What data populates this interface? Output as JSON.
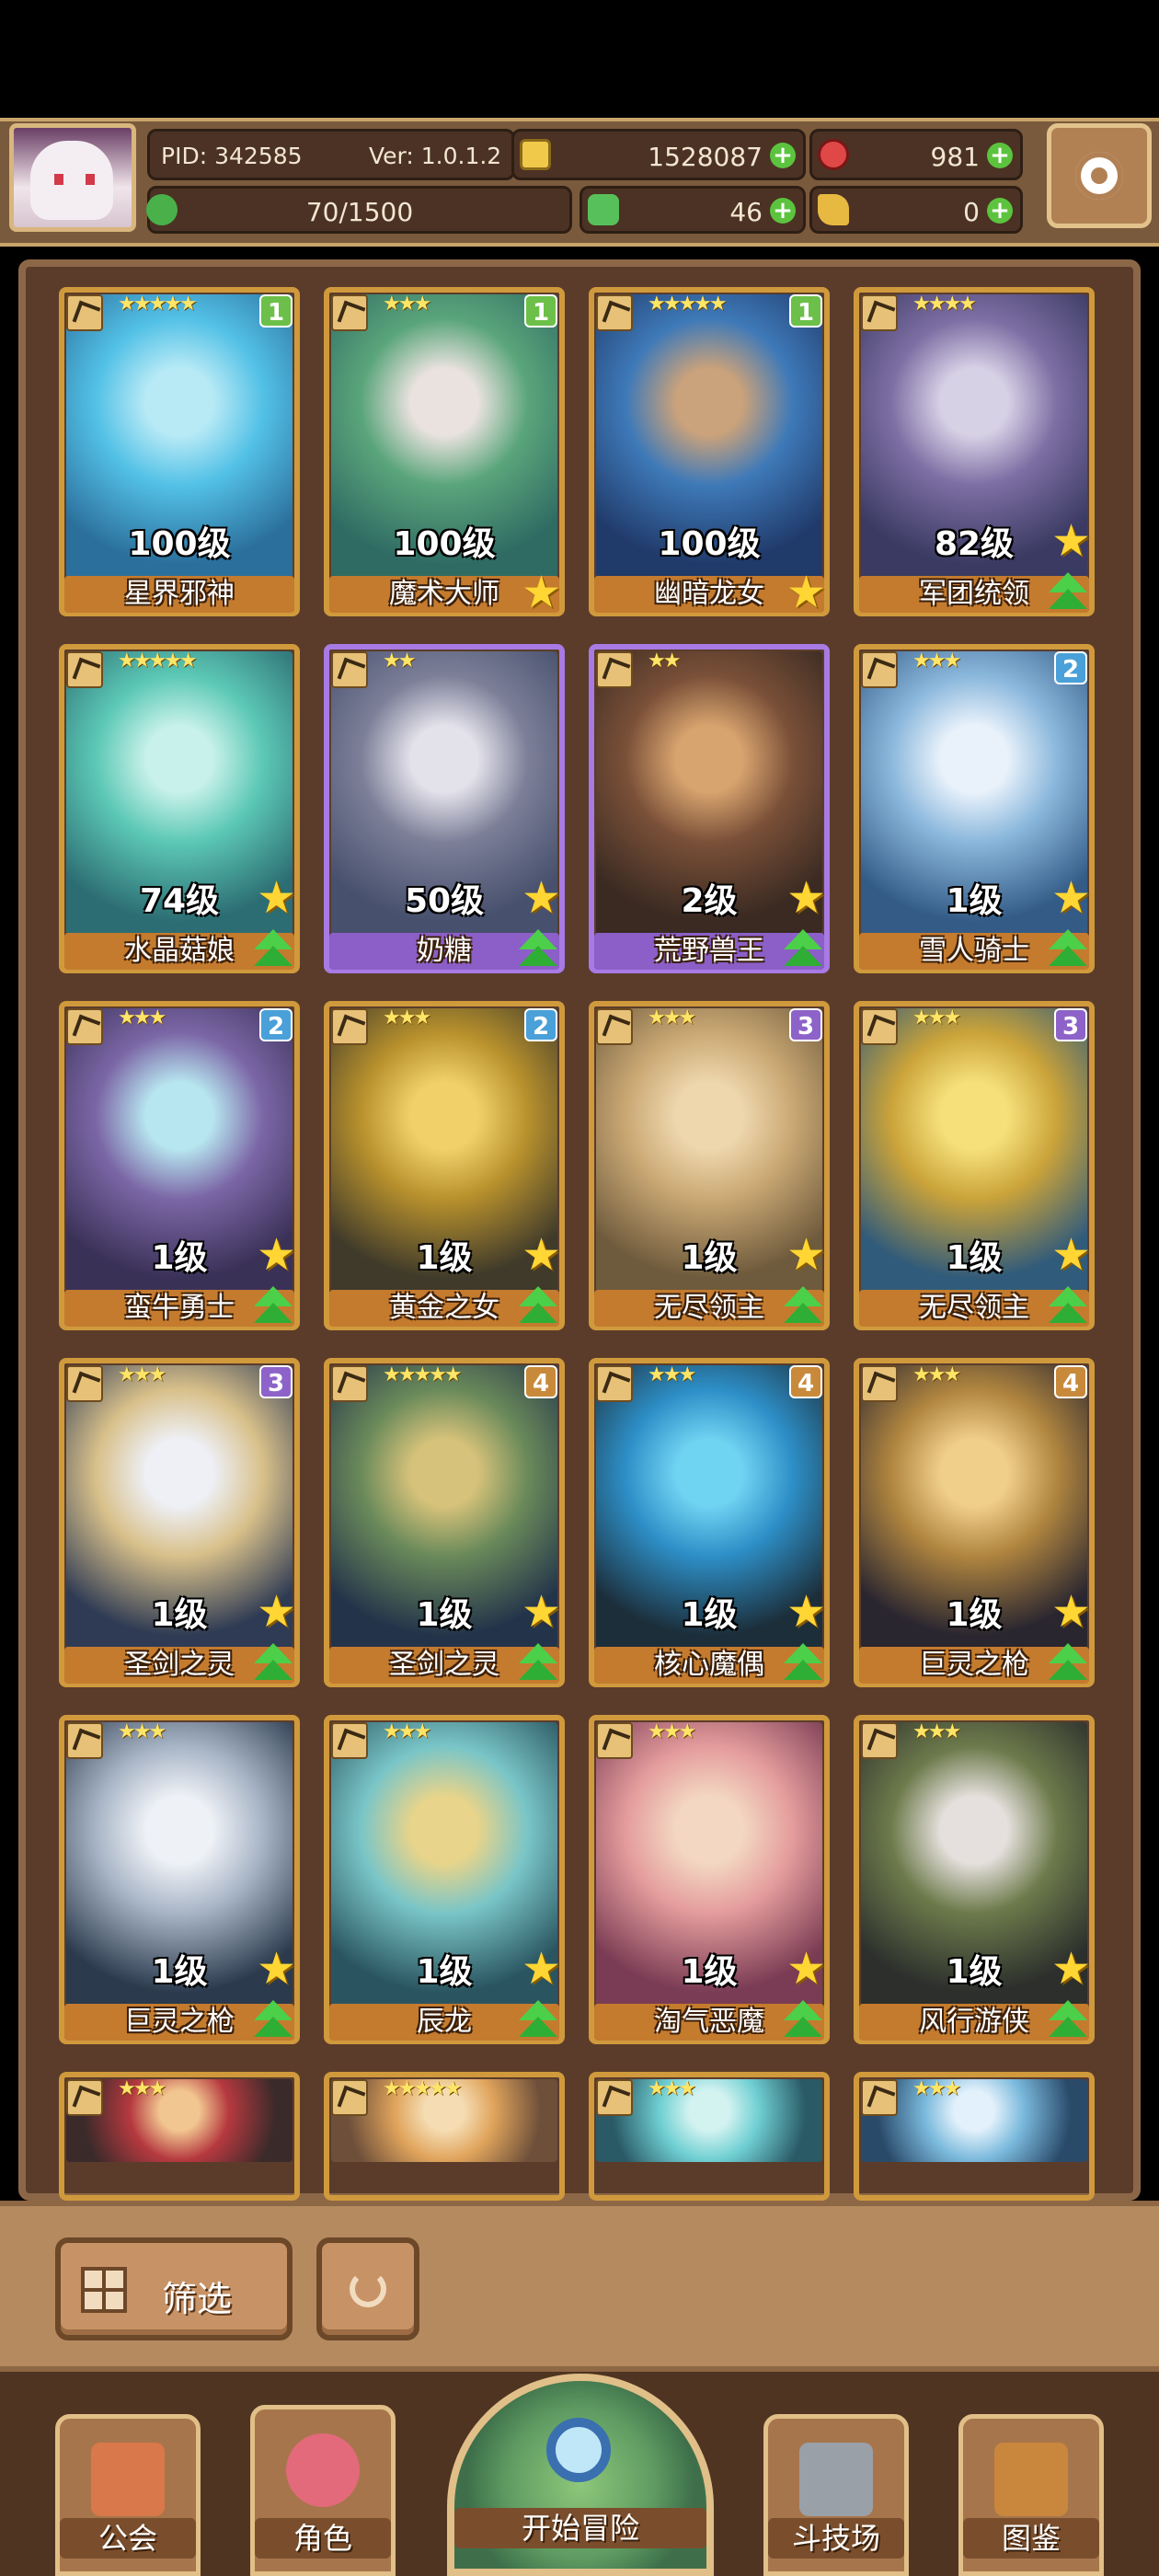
{
  "header": {
    "pid": "PID: 342585",
    "version": "Ver: 1.0.1.2",
    "gold": "1528087",
    "gems": "981",
    "stamina": "70/1500",
    "clover": "46",
    "key": "0"
  },
  "colors": {
    "gold_badge": "#4aa0d8",
    "badge_1": "#6cc04a",
    "badge_2": "#4aa0d8",
    "badge_3": "#8d63c9",
    "badge_4": "#c88a3a",
    "gold_frame": "#d09a3c",
    "purple_frame": "#a77ae4"
  },
  "cards": [
    {
      "name": "星界邪神",
      "level": "100级",
      "stars": "★★★★★",
      "badge": "1",
      "badge_type": "badge_1",
      "frame": "gold",
      "art": [
        "#2b6f9c",
        "#53c1e6",
        "#b8eaf6"
      ]
    },
    {
      "name": "魔术大师",
      "level": "100级",
      "stars": "★★★",
      "badge": "1",
      "badge_type": "badge_1",
      "frame": "gold",
      "art": [
        "#2f6b63",
        "#5aa57b",
        "#eae2de"
      ]
    },
    {
      "name": "幽暗龙女",
      "level": "100级",
      "stars": "★★★★★",
      "badge": "1",
      "badge_type": "badge_1",
      "frame": "gold",
      "art": [
        "#203a6a",
        "#3e79b8",
        "#caa27b"
      ]
    },
    {
      "name": "军团统领",
      "level": "82级",
      "stars": "★★★★",
      "badge": "",
      "badge_type": "",
      "frame": "gold",
      "art": [
        "#3a3a62",
        "#7d6ea3",
        "#d7d1e6"
      ]
    },
    {
      "name": "水晶菇娘",
      "level": "74级",
      "stars": "★★★★★",
      "badge": "",
      "badge_type": "",
      "frame": "gold",
      "art": [
        "#2c6d73",
        "#5cc8b5",
        "#c7f1ea"
      ]
    },
    {
      "name": "奶糖",
      "level": "50级",
      "stars": "★★",
      "badge": "",
      "badge_type": "",
      "frame": "purple",
      "art": [
        "#47506d",
        "#7c7f98",
        "#e3e1ea"
      ]
    },
    {
      "name": "荒野兽王",
      "level": "2级",
      "stars": "★★",
      "badge": "",
      "badge_type": "",
      "frame": "purple",
      "art": [
        "#3a2a22",
        "#7a5038",
        "#d7a36e"
      ]
    },
    {
      "name": "雪人骑士",
      "level": "1级",
      "stars": "★★★",
      "badge": "2",
      "badge_type": "badge_2",
      "frame": "gold",
      "art": [
        "#335b86",
        "#8ab7dc",
        "#e9f2fb"
      ]
    },
    {
      "name": "蛮牛勇士",
      "level": "1级",
      "stars": "★★★",
      "badge": "2",
      "badge_type": "badge_2",
      "frame": "gold",
      "art": [
        "#3a3157",
        "#7b66a6",
        "#b7e6f0"
      ]
    },
    {
      "name": "黄金之女",
      "level": "1级",
      "stars": "★★★",
      "badge": "2",
      "badge_type": "badge_2",
      "frame": "gold",
      "art": [
        "#3f3a2a",
        "#b8912d",
        "#f1d06a"
      ]
    },
    {
      "name": "无尽领主",
      "level": "1级",
      "stars": "★★★",
      "badge": "3",
      "badge_type": "badge_3",
      "frame": "gold",
      "art": [
        "#6e5a3c",
        "#caa874",
        "#eed7ad"
      ]
    },
    {
      "name": "无尽领主",
      "level": "1级",
      "stars": "★★★",
      "badge": "3",
      "badge_type": "badge_3",
      "frame": "gold",
      "art": [
        "#315b7a",
        "#caa33a",
        "#f6e07a"
      ]
    },
    {
      "name": "圣剑之灵",
      "level": "1级",
      "stars": "★★★",
      "badge": "3",
      "badge_type": "badge_3",
      "frame": "gold",
      "art": [
        "#2f3b54",
        "#d8c08a",
        "#eef0f6"
      ]
    },
    {
      "name": "圣剑之灵",
      "level": "1级",
      "stars": "★★★★★",
      "badge": "4",
      "badge_type": "badge_4",
      "frame": "gold",
      "art": [
        "#23344a",
        "#6a8a5a",
        "#d6c27a"
      ]
    },
    {
      "name": "核心魔偶",
      "level": "1级",
      "stars": "★★★",
      "badge": "4",
      "badge_type": "badge_4",
      "frame": "gold",
      "art": [
        "#1c2e3a",
        "#2d8fc7",
        "#6fd3f2"
      ]
    },
    {
      "name": "巨灵之枪",
      "level": "1级",
      "stars": "★★★",
      "badge": "4",
      "badge_type": "badge_4",
      "frame": "gold",
      "art": [
        "#2a2630",
        "#b0853f",
        "#f0cf8b"
      ]
    },
    {
      "name": "巨灵之枪",
      "level": "1级",
      "stars": "★★★",
      "badge": "",
      "badge_type": "",
      "frame": "gold",
      "art": [
        "#2b3a4d",
        "#a8b5c6",
        "#eef1f6"
      ]
    },
    {
      "name": "辰龙",
      "level": "1级",
      "stars": "★★★",
      "badge": "",
      "badge_type": "",
      "frame": "gold",
      "art": [
        "#2a5560",
        "#79c5c7",
        "#e8d48a"
      ]
    },
    {
      "name": "淘气恶魔",
      "level": "1级",
      "stars": "★★★",
      "badge": "",
      "badge_type": "",
      "frame": "gold",
      "art": [
        "#7a3c54",
        "#e49c9c",
        "#f3d7c2"
      ]
    },
    {
      "name": "风行游侠",
      "level": "1级",
      "stars": "★★★",
      "badge": "",
      "badge_type": "",
      "frame": "gold",
      "art": [
        "#2c2f2c",
        "#6d7a4b",
        "#e5e0dd"
      ]
    },
    {
      "name": "",
      "level": "",
      "stars": "★★★",
      "badge": "",
      "badge_type": "",
      "frame": "gold",
      "art": [
        "#3a2a2a",
        "#b5393f",
        "#f2c690"
      ]
    },
    {
      "name": "",
      "level": "",
      "stars": "★★★★★",
      "badge": "",
      "badge_type": "",
      "frame": "gold",
      "art": [
        "#6d4f3a",
        "#e0a45c",
        "#f5dcb2"
      ]
    },
    {
      "name": "",
      "level": "",
      "stars": "★★★",
      "badge": "",
      "badge_type": "",
      "frame": "gold",
      "art": [
        "#2a5a66",
        "#6fcfd2",
        "#d3f3f1"
      ]
    },
    {
      "name": "",
      "level": "",
      "stars": "★★★",
      "badge": "",
      "badge_type": "",
      "frame": "gold",
      "art": [
        "#2a4a6a",
        "#7ab9dc",
        "#e2f1fb"
      ]
    }
  ],
  "controls": {
    "filter_label": "筛选"
  },
  "nav": [
    {
      "label": "公会",
      "icon": "guild-icon"
    },
    {
      "label": "角色",
      "icon": "character-icon"
    },
    {
      "label": "开始冒险",
      "icon": "map-icon"
    },
    {
      "label": "斗技场",
      "icon": "arena-icon"
    },
    {
      "label": "图鉴",
      "icon": "codex-icon"
    }
  ]
}
